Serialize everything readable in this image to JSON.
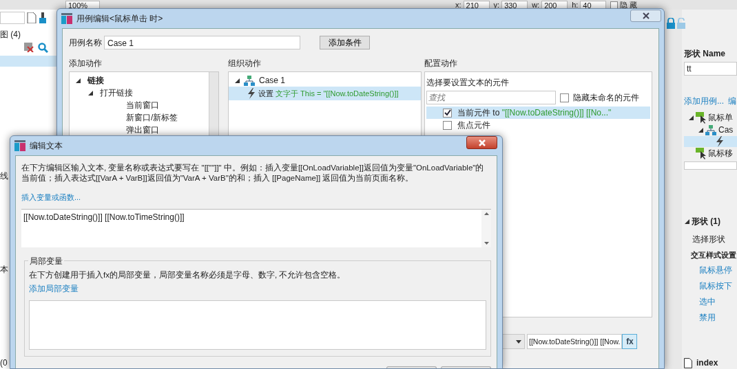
{
  "toolbar": {
    "zoom": "100%",
    "coords": [
      {
        "label": "x:",
        "value": "210"
      },
      {
        "label": "y:",
        "value": "330"
      },
      {
        "label": "w:",
        "value": "200"
      },
      {
        "label": "h:",
        "value": "40"
      }
    ],
    "hidden": {
      "label": "隐 藏",
      "checked": false
    }
  },
  "left_panel": {
    "title": "图 (4)",
    "fragments": [
      "线",
      "本",
      "(0"
    ]
  },
  "right_panel": {
    "name_label": "形状 Name",
    "name_value": "tt",
    "links": [
      "添加用例...",
      "编"
    ],
    "events": [
      {
        "label": "鼠标单",
        "kind": "event",
        "expanded": true,
        "selected": false,
        "children": [
          {
            "label": "Cas",
            "kind": "case",
            "expanded": true,
            "selected": false,
            "children": [
              {
                "kind": "action",
                "selected": true
              }
            ]
          }
        ]
      },
      {
        "label": "鼠标移",
        "kind": "event",
        "selected": false
      }
    ],
    "section_title": "形状 (1)",
    "select_label": "选择形状",
    "style_title": "交互样式设置",
    "style_links": [
      "鼠标悬停",
      "鼠标按下",
      "选中",
      "禁用"
    ],
    "page": "index"
  },
  "case_dialog": {
    "title": "用例编辑<鼠标单击 时>",
    "name_label": "用例名称",
    "name_value": "Case 1",
    "add_condition": "添加条件",
    "add_actions": {
      "heading": "添加动作",
      "items": [
        {
          "label": "链接",
          "expanded": true,
          "children": [
            {
              "label": "打开链接",
              "expanded": true,
              "children": [
                {
                  "label": "当前窗口"
                },
                {
                  "label": "新窗口/新标签"
                },
                {
                  "label": "弹出窗口"
                }
              ]
            }
          ]
        }
      ]
    },
    "organize": {
      "heading": "组织动作",
      "case": "Case 1",
      "actions": [
        {
          "verb": "设置",
          "detail": "文字于 This = \"[[Now.toDateString()]]",
          "selected": true
        }
      ]
    },
    "configure": {
      "heading": "配置动作",
      "subheading": "选择要设置文本的元件",
      "search_placeholder": "查找",
      "hide_unnamed": {
        "label": "隐藏未命名的元件",
        "checked": false
      },
      "widgets": [
        {
          "label": "当前元件 to",
          "value": "\"[[Now.toDateString()]] [[No...\"",
          "checked": true,
          "selected": true
        },
        {
          "label": "焦点元件",
          "checked": false,
          "selected": false
        }
      ],
      "value_field": "[[Now.toDateString()]] [[Now.",
      "fx": "fx"
    }
  },
  "edit_text_dialog": {
    "title": "编辑文本",
    "description": "在下方编辑区输入文本, 变量名称或表达式要写在 \"[[\"\"]]\" 中。例如：插入变量[[OnLoadVariable]]返回值为变量\"OnLoadVariable\"的当前值；插入表达式[[VarA + VarB]]返回值为\"VarA + VarB\"的和；插入 [[PageName]] 返回值为当前页面名称。",
    "insert_link": "插入变量或函数...",
    "text": "[[Now.toDateString()]] [[Now.toTimeString()]]",
    "local_vars": {
      "legend": "局部变量",
      "description": "在下方创建用于插入fx的局部变量，局部变量名称必须是字母、数字, 不允许包含空格。",
      "add_link": "添加局部变量"
    }
  }
}
